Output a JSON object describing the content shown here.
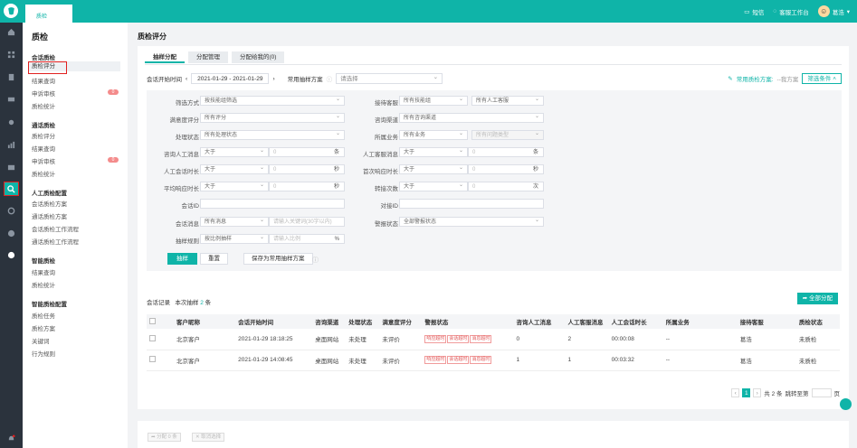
{
  "topbar": {
    "tab": "质检",
    "sms": "短信",
    "workbench": "客服工作台",
    "user": "葛浩"
  },
  "subnav": {
    "title": "质检",
    "groups": [
      {
        "label": "会话质检",
        "items": [
          {
            "label": "质检评分",
            "active": true
          },
          {
            "label": "结果查询"
          },
          {
            "label": "申诉审核",
            "badge": "0"
          },
          {
            "label": "质检统计"
          }
        ]
      },
      {
        "label": "通话质检",
        "items": [
          {
            "label": "质检评分"
          },
          {
            "label": "结果查询"
          },
          {
            "label": "申诉审核",
            "badge": "0"
          },
          {
            "label": "质检统计"
          }
        ]
      },
      {
        "label": "人工质检配置",
        "items": [
          {
            "label": "会话质检方案"
          },
          {
            "label": "通话质检方案"
          },
          {
            "label": "会话质检工作流程"
          },
          {
            "label": "通话质检工作流程"
          }
        ]
      },
      {
        "label": "智能质检",
        "items": [
          {
            "label": "结果查询"
          },
          {
            "label": "质检统计"
          }
        ]
      },
      {
        "label": "智能质检配置",
        "items": [
          {
            "label": "质检任务"
          },
          {
            "label": "质检方案"
          },
          {
            "label": "关键词"
          },
          {
            "label": "行为规则"
          }
        ]
      }
    ]
  },
  "page": {
    "title": "质检评分",
    "tabs": [
      "抽样分配",
      "分配管理",
      "分配给我的(0)"
    ]
  },
  "row1": {
    "date_label": "会话开始时间",
    "date_value": "2021-01-29 - 2021-01-29",
    "plan_label": "常用抽样方案",
    "plan_placeholder": "请选择",
    "common_plan": "常用质检方案:",
    "common_plan_value": "--我方案",
    "filter_btn": "筛选条件"
  },
  "filters": {
    "l1": {
      "label": "筛选方式",
      "value": "按技能组筛选"
    },
    "l2": {
      "label": "满意度评分",
      "value": "所有评分"
    },
    "l3": {
      "label": "处理状态",
      "value": "所有处理状态"
    },
    "l4": {
      "label": "咨询人工消息",
      "op": "大于",
      "ph": "0",
      "unit": "条"
    },
    "l5": {
      "label": "人工会话时长",
      "op": "大于",
      "ph": "0",
      "unit": "秒"
    },
    "l6": {
      "label": "平均响应时长",
      "op": "大于",
      "ph": "0",
      "unit": "秒"
    },
    "l7": {
      "label": "会话ID"
    },
    "l8": {
      "label": "会话消息",
      "value": "所有消息",
      "ph": "请输入关键词(30字以内)"
    },
    "l9": {
      "label": "抽样规则",
      "value": "按比例抽样",
      "ph": "请输入比例",
      "unit": "%"
    },
    "r1": {
      "label": "接待客服",
      "v1": "所有技能组",
      "v2": "所有人工客服"
    },
    "r2": {
      "label": "咨询渠道",
      "value": "所有咨询渠道"
    },
    "r3": {
      "label": "所属业务",
      "v1": "所有业务",
      "v2": "所有问题类型"
    },
    "r4": {
      "label": "人工客服消息",
      "op": "大于",
      "ph": "0",
      "unit": "条"
    },
    "r5": {
      "label": "首次响应时长",
      "op": "大于",
      "ph": "0",
      "unit": "秒"
    },
    "r6": {
      "label": "转接次数",
      "op": "大于",
      "ph": "0",
      "unit": "次"
    },
    "r7": {
      "label": "对接ID"
    },
    "r8": {
      "label": "警报状态",
      "value": "全部警报状态"
    }
  },
  "buttons": {
    "sample": "抽样",
    "reset": "重置",
    "save": "保存为常用抽样方案"
  },
  "records": {
    "label": "会话记录",
    "count_prefix": "本次抽样",
    "count": "2",
    "count_suffix": "条",
    "all_assign": "全部分配"
  },
  "table": {
    "headers": [
      "客户昵称",
      "会话开始时间",
      "咨询渠道",
      "处理状态",
      "满意度评分",
      "警报状态",
      "咨询人工消息",
      "人工客服消息",
      "人工会话时长",
      "所属业务",
      "接待客服",
      "质检状态"
    ],
    "rows": [
      [
        "北京客户",
        "2021-01-29 18:18:25",
        "桌面网站",
        "未处理",
        "未评价",
        "",
        "0",
        "2",
        "00:00:08",
        "--",
        "葛浩",
        "未质检"
      ],
      [
        "北京客户",
        "2021-01-29 14:08:45",
        "桌面网站",
        "未处理",
        "未评价",
        "",
        "1",
        "1",
        "00:03:32",
        "--",
        "葛浩",
        "未质检"
      ]
    ],
    "warn_tags": [
      "响应超时",
      "会话超时",
      "消息超时"
    ]
  },
  "pager": {
    "page": "1",
    "total": "共 2 条",
    "jump": "跳转至第",
    "page_unit": "页"
  },
  "bottom": {
    "assign": "分配 0 条",
    "cancel": "取消选择"
  }
}
